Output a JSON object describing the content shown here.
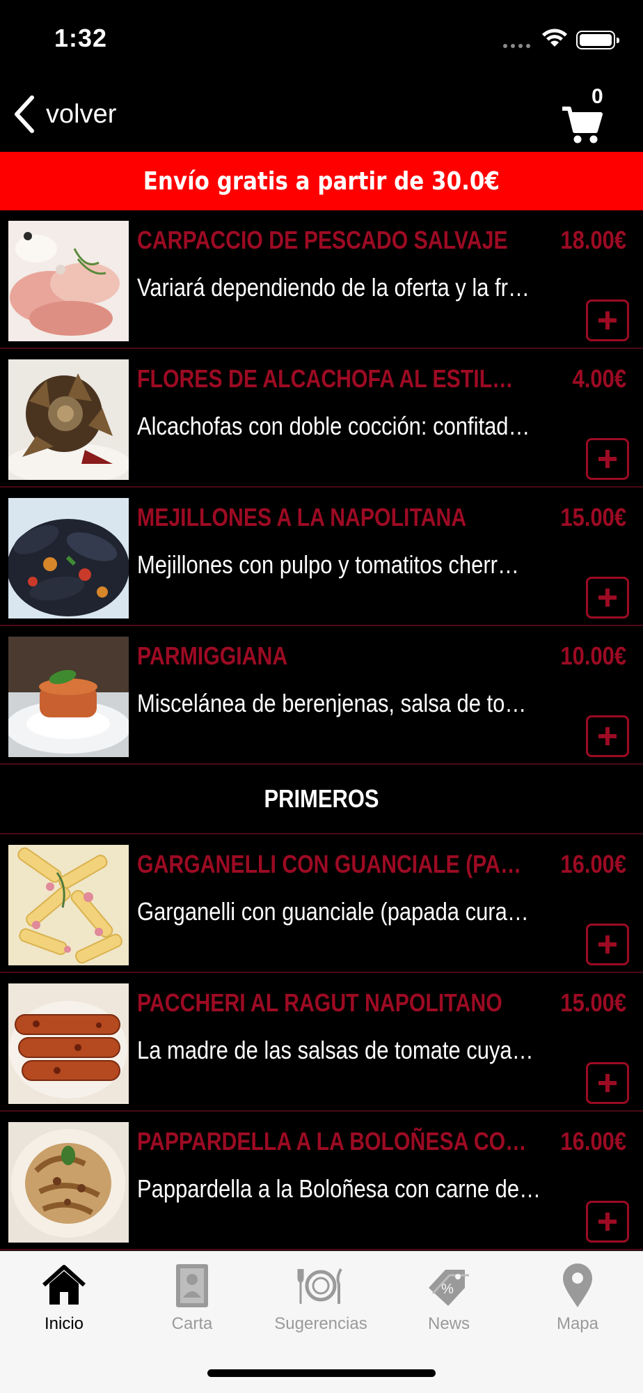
{
  "status_bar": {
    "time": "1:32"
  },
  "nav": {
    "back_label": "volver",
    "cart_count": "0"
  },
  "promo": {
    "text": "Envío gratis a partir de 30.0€"
  },
  "sections": {
    "first_items": [
      {
        "name": "CARPACCIO DE PESCADO SALVAJE",
        "price": "18.00€",
        "desc": "Variará dependiendo de la oferta y la fr…"
      },
      {
        "name": "FLORES DE ALCACHOFA AL ESTILO…",
        "price": "4.00€",
        "desc": "Alcachofas con doble cocción: confitad…"
      },
      {
        "name": "MEJILLONES A LA NAPOLITANA",
        "price": "15.00€",
        "desc": "Mejillones con pulpo y tomatitos cherr…"
      },
      {
        "name": "PARMIGGIANA",
        "price": "10.00€",
        "desc": "Miscelánea de berenjenas, salsa de to…"
      }
    ],
    "primeros_title": "PRIMEROS",
    "primeros_items": [
      {
        "name": "GARGANELLI CON GUANCIALE (PA…",
        "price": "16.00€",
        "desc": "Garganelli con guanciale (papada cura…"
      },
      {
        "name": "PACCHERI AL RAGUT NAPOLITANO",
        "price": "15.00€",
        "desc": "La madre de las salsas de tomate cuya…"
      },
      {
        "name": "PAPPARDELLA A LA BOLOÑESA CO…",
        "price": "16.00€",
        "desc": "Pappardella a la Boloñesa con carne de…"
      }
    ]
  },
  "tabs": [
    {
      "label": "Inicio",
      "icon": "home-icon",
      "active": true
    },
    {
      "label": "Carta",
      "icon": "menu-card-icon",
      "active": false
    },
    {
      "label": "Sugerencias",
      "icon": "plate-cutlery-icon",
      "active": false
    },
    {
      "label": "News",
      "icon": "tag-icon",
      "active": false
    },
    {
      "label": "Mapa",
      "icon": "map-pin-icon",
      "active": false
    }
  ],
  "colors": {
    "accent": "#9c0b23",
    "banner": "#ff0000",
    "background": "#000000",
    "tab_bar": "#f6f6f6"
  }
}
